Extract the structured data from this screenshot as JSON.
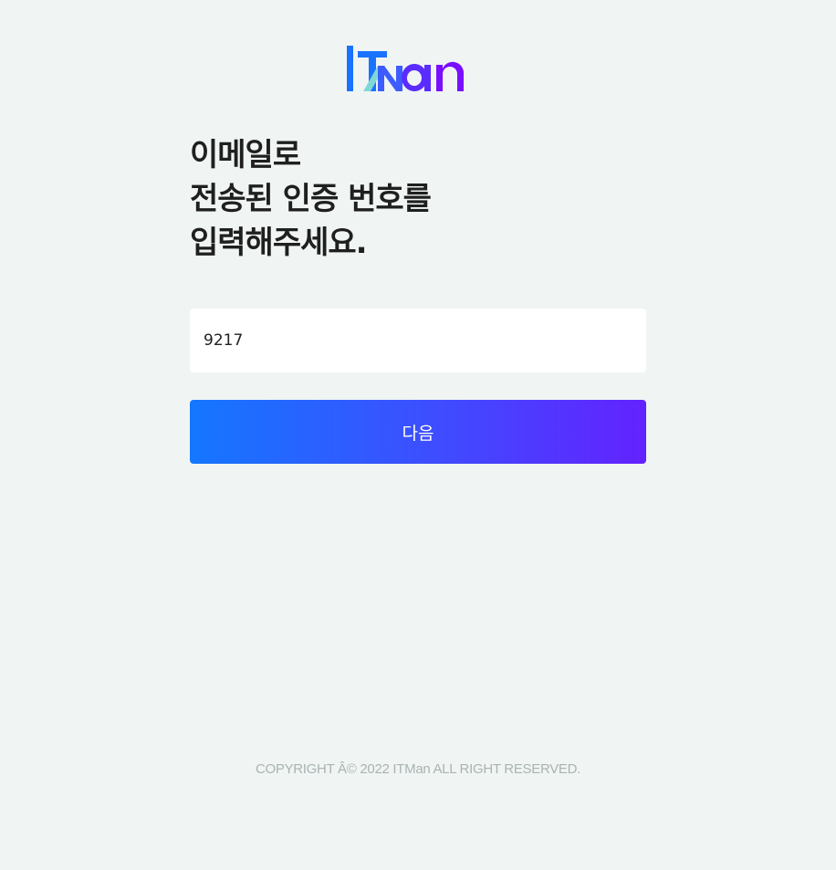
{
  "logo": {
    "text": "ITMan",
    "colors": {
      "blue": "#1a73ff",
      "teal": "#7fd8d6",
      "purple": "#7a0eff"
    }
  },
  "heading": {
    "line1": "이메일로",
    "line2": "전송된 인증 번호를",
    "line3": "입력해주세요."
  },
  "verification": {
    "code_value": "9217"
  },
  "next_button": {
    "label": "다음",
    "gradient_start": "#1477ff",
    "gradient_end": "#6322ff"
  },
  "footer": {
    "copyright": "COPYRIGHT Â© 2022 ITMan ALL RIGHT RESERVED."
  }
}
